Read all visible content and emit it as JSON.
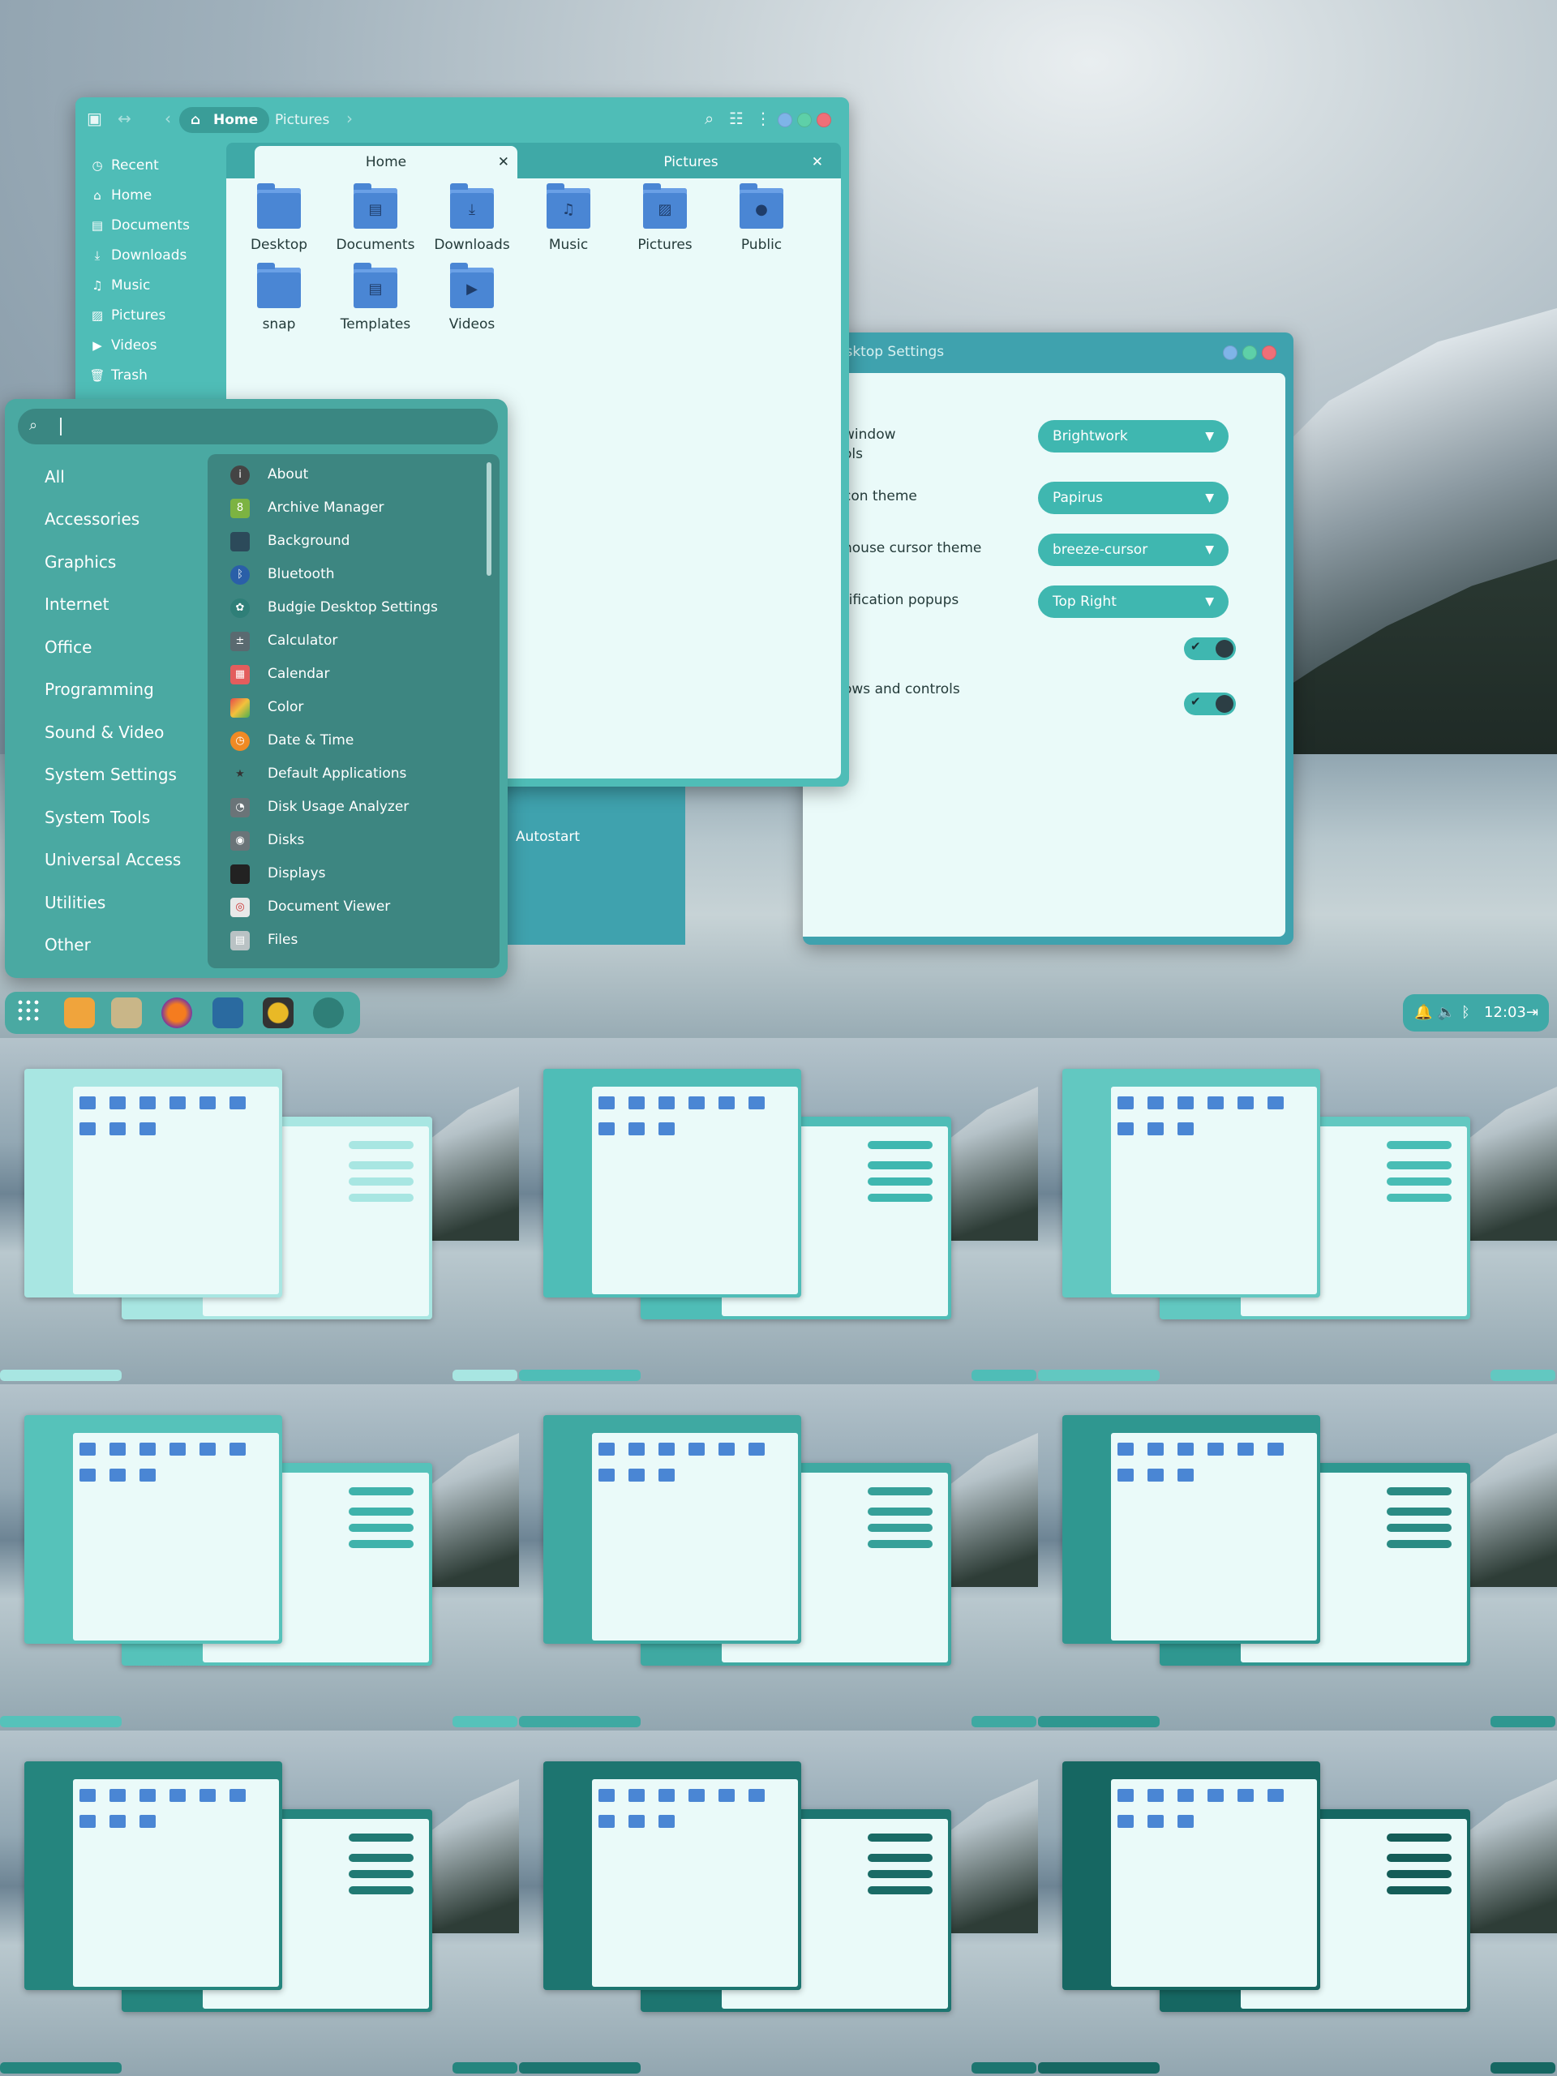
{
  "colors": {
    "accent": "#4fbdb7",
    "accent_dark": "#3a9d98",
    "content_bg": "#eafaf9",
    "folder": "#4a86d4",
    "menu_bg": "#4aa9a2",
    "apps_bg": "#3d8681"
  },
  "files": {
    "breadcrumbs": [
      "Home",
      "Pictures"
    ],
    "sidebar": [
      {
        "label": "Recent",
        "icon": "clock-icon"
      },
      {
        "label": "Home",
        "icon": "home-icon"
      },
      {
        "label": "Documents",
        "icon": "document-icon"
      },
      {
        "label": "Downloads",
        "icon": "download-icon"
      },
      {
        "label": "Music",
        "icon": "music-icon"
      },
      {
        "label": "Pictures",
        "icon": "picture-icon"
      },
      {
        "label": "Videos",
        "icon": "video-icon"
      },
      {
        "label": "Trash",
        "icon": "trash-icon"
      }
    ],
    "tabs": [
      "Home",
      "Pictures"
    ],
    "folders": [
      "Desktop",
      "Documents",
      "Downloads",
      "Music",
      "Pictures",
      "Public",
      "snap",
      "Templates",
      "Videos"
    ]
  },
  "settings": {
    "title": "esktop Settings",
    "rows": [
      "window",
      "ols",
      "con theme",
      "nouse cursor theme",
      "tification popups",
      "ows and controls"
    ],
    "dropdowns": [
      "Brightwork",
      "Papirus",
      "breeze-cursor",
      "Top Right"
    ],
    "behind_label": "Autostart"
  },
  "menu": {
    "search_placeholder": "",
    "categories": [
      "All",
      "Accessories",
      "Graphics",
      "Internet",
      "Office",
      "Programming",
      "Sound & Video",
      "System Settings",
      "System Tools",
      "Universal Access",
      "Utilities",
      "Other"
    ],
    "apps": [
      "About",
      "Archive Manager",
      "Background",
      "Bluetooth",
      "Budgie Desktop Settings",
      "Calculator",
      "Calendar",
      "Color",
      "Date & Time",
      "Default Applications",
      "Disk Usage Analyzer",
      "Disks",
      "Displays",
      "Document Viewer",
      "Files"
    ]
  },
  "tray": {
    "clock": "12:03"
  },
  "thumbs": {
    "variants": [
      {
        "frame": "#a8e6e2",
        "drop": "#a8e6e2"
      },
      {
        "frame": "#4fbdb7",
        "drop": "#3fb7b0"
      },
      {
        "frame": "#62c8c1",
        "drop": "#48bdb5"
      },
      {
        "frame": "#56c2ba",
        "drop": "#3fb2ab"
      },
      {
        "frame": "#3fa9a2",
        "drop": "#36a099"
      },
      {
        "frame": "#2f9790",
        "drop": "#2a8b84"
      },
      {
        "frame": "#25857e",
        "drop": "#217a74"
      },
      {
        "frame": "#1d7570",
        "drop": "#1a6b66"
      },
      {
        "frame": "#166762",
        "drop": "#145d58"
      }
    ]
  }
}
